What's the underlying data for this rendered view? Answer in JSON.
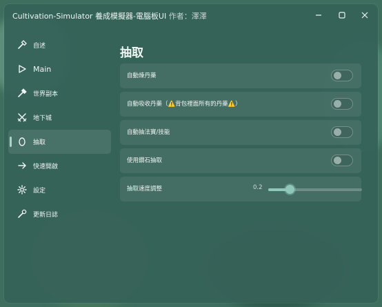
{
  "window": {
    "title": "Cultivation-Simulator 養成模擬器-電腦板UI",
    "author": "作者：澤澤"
  },
  "sidebar": {
    "items": [
      {
        "label": "自述",
        "icon": "hammer-icon"
      },
      {
        "label": "Main",
        "icon": "play-icon"
      },
      {
        "label": "世界副本",
        "icon": "hammer-icon"
      },
      {
        "label": "地下城",
        "icon": "crossed-swords-icon"
      },
      {
        "label": "抽取",
        "icon": "egg-icon",
        "active": true
      },
      {
        "label": "快速開啟",
        "icon": "arrow-right-icon"
      },
      {
        "label": "設定",
        "icon": "gear-icon"
      },
      {
        "label": "更新日誌",
        "icon": "wrench-icon"
      }
    ]
  },
  "main": {
    "title": "抽取",
    "rows": [
      {
        "label": "自動煉丹藥",
        "type": "toggle",
        "on": false
      },
      {
        "label": "自動吸收丹藥（⚠️背包裡面所有的丹藥⚠️）",
        "type": "toggle",
        "on": false
      },
      {
        "label": "自動抽法寶/技能",
        "type": "toggle",
        "on": false
      },
      {
        "label": "使用鑽石抽取",
        "type": "toggle",
        "on": false
      },
      {
        "label": "抽取速度調整",
        "type": "slider",
        "value_text": "0.2",
        "value_fraction": 0.23
      }
    ]
  },
  "colors": {
    "window_bg": "#366258",
    "accent": "#8fc8ba"
  }
}
